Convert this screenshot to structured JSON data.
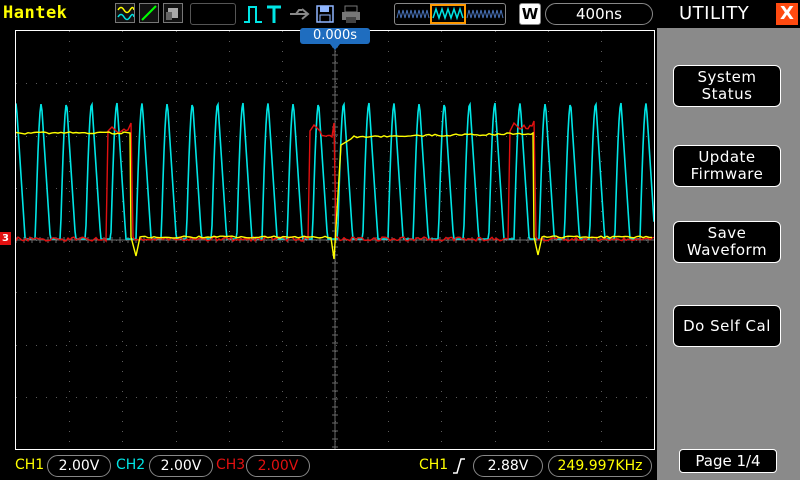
{
  "brand": "Hantek",
  "timebase": "400ns",
  "mode_letter": "W",
  "trigger_time": "0.000s",
  "ch3_marker": "3",
  "channels": [
    {
      "label": "CH1",
      "value": "2.00V",
      "color": "#ffff00"
    },
    {
      "label": "CH2",
      "value": "2.00V",
      "color": "#00e5e5"
    },
    {
      "label": "CH3",
      "value": "2.00V",
      "color": "#e21010"
    }
  ],
  "trigger": {
    "source": "CH1",
    "level": "2.88V",
    "frequency": "249.997KHz"
  },
  "menu": {
    "title": "UTILITY",
    "close": "X",
    "items": [
      "System\nStatus",
      "Update\nFirmware",
      "Save\nWaveform",
      "Do Self Cal"
    ],
    "page": "Page 1/4"
  },
  "colors": {
    "ch1": "#ffff00",
    "ch2": "#00e5e5",
    "ch3": "#e21010",
    "menu_bg": "#8a8a8a",
    "accent": "#ff4a10"
  }
}
